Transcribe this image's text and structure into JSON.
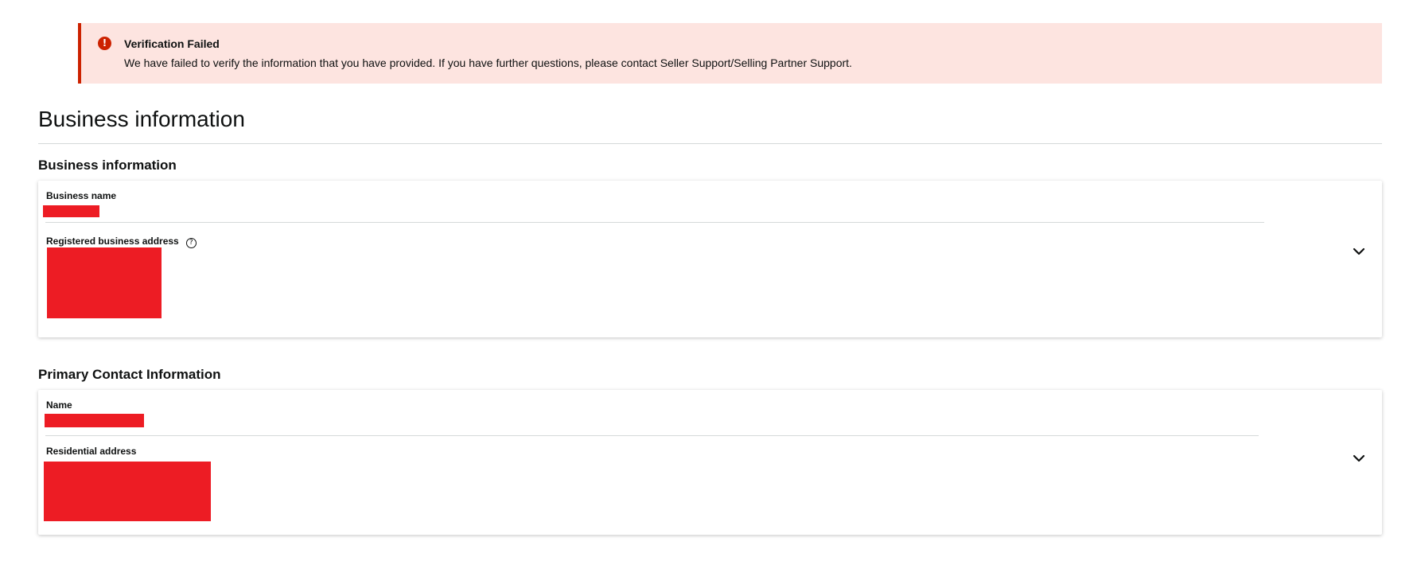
{
  "alert": {
    "icon": "exclamation-icon",
    "icon_glyph": "!",
    "title": "Verification Failed",
    "message": "We have failed to verify the information that you have provided. If you have further questions, please contact Seller Support/Selling Partner Support.",
    "background_color": "#fde4e0",
    "accent_color": "#cc2200"
  },
  "page": {
    "title": "Business information"
  },
  "business_section": {
    "heading": "Business information",
    "fields": [
      {
        "label": "Business name",
        "value_redacted": true
      },
      {
        "label": "Registered business address",
        "help_icon": "question-circle-icon",
        "help_glyph": "?",
        "value_redacted": true
      }
    ],
    "expand_icon": "chevron-down-icon"
  },
  "contact_section": {
    "heading": "Primary Contact Information",
    "fields": [
      {
        "label": "Name",
        "value_redacted": true
      },
      {
        "label": "Residential address",
        "value_redacted": true
      }
    ],
    "expand_icon": "chevron-down-icon"
  },
  "colors": {
    "redaction": "#ed1c24",
    "text": "#0f1111",
    "divider": "#d5d9d9"
  }
}
